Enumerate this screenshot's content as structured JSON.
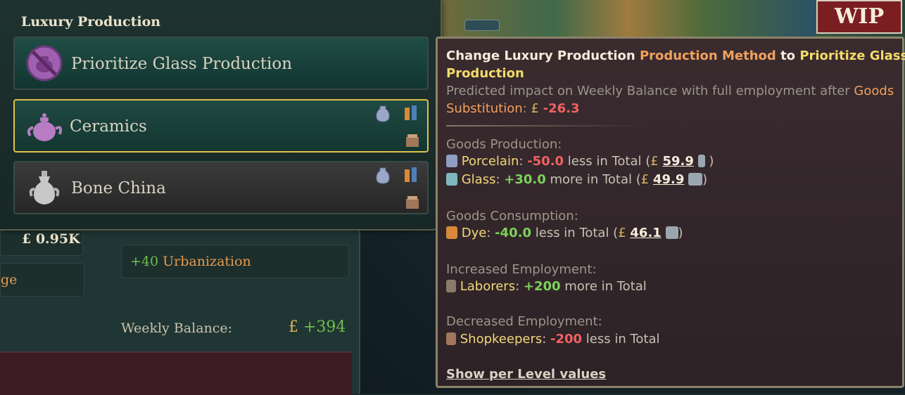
{
  "luxury_panel": {
    "title": "Luxury Production",
    "options": [
      {
        "label": "Prioritize Glass Production",
        "icon": "no-teapot-icon",
        "selected": false
      },
      {
        "label": "Ceramics",
        "icon": "teapot-icon",
        "selected": true
      },
      {
        "label": "Bone China",
        "icon": "vase-icon",
        "selected": false
      }
    ]
  },
  "base": {
    "money": "£ 0.95K",
    "urban_value": "+40",
    "urban_label": "Urbanization",
    "partial_text": "ge",
    "weekly_label": "Weekly Balance:",
    "weekly_currency": "£",
    "weekly_value": "+394"
  },
  "tooltip": {
    "head1": "Change Luxury Production ",
    "head_pm": "Production Method",
    "head_to": " to ",
    "head_target1": "Prioritize Glass",
    "head_target2": "Production",
    "predicted": "Predicted impact on Weekly Balance with full employment after ",
    "goods_sub1": "Goods",
    "goods_sub2": "Substitution",
    "colon": ": ",
    "impact_currency": "£",
    "impact_value": "-26.3",
    "goods_production_header": "Goods Production:",
    "production": [
      {
        "good": "Porcelain",
        "delta": "-50.0",
        "word": " less in Total (",
        "price": "59.9",
        "icon": "porcelain-icon"
      },
      {
        "good": "Glass",
        "delta": "+30.0",
        "word": " more in Total (",
        "price": "49.9",
        "icon": "glass-icon"
      }
    ],
    "goods_consumption_header": "Goods Consumption:",
    "consumption": [
      {
        "good": "Dye",
        "delta": "-40.0",
        "word": " less in Total (",
        "price": "46.1",
        "icon": "dye-icon"
      }
    ],
    "increased_header": "Increased Employment:",
    "increased": {
      "pop": "Laborers",
      "delta": "+200",
      "word": " more in Total",
      "icon": "shovel-icon"
    },
    "decreased_header": "Decreased Employment:",
    "decreased": {
      "pop": "Shopkeepers",
      "delta": "-200",
      "word": " less in Total",
      "icon": "shop-icon"
    },
    "link": "Show per Level values",
    "price_currency": "£"
  },
  "wip_badge": "WIP"
}
